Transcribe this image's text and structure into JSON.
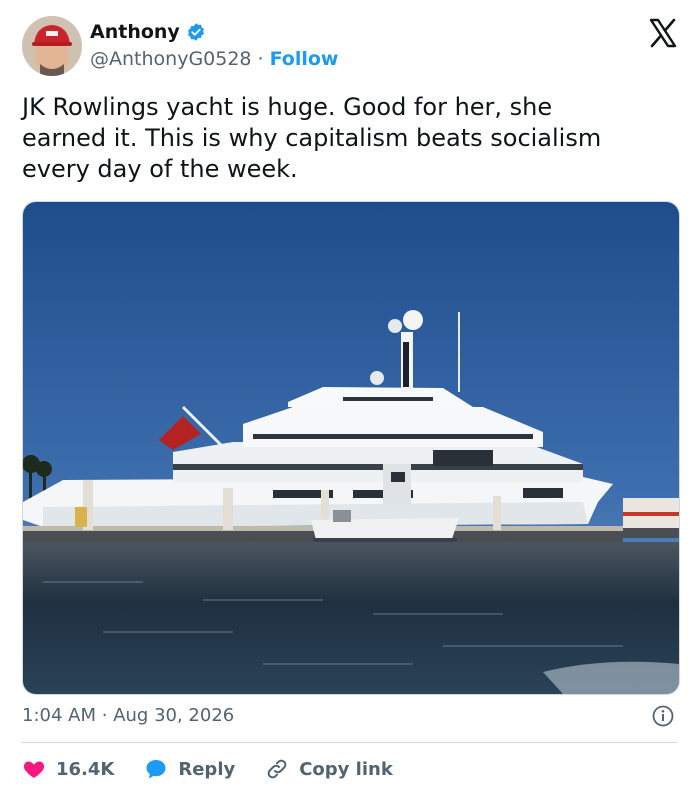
{
  "author": {
    "name": "Anthony",
    "handle": "@AnthonyG0528",
    "separator": "·",
    "follow_label": "Follow"
  },
  "tweet": {
    "text": "JK Rowlings yacht is huge. Good for her, she\nearned it. This is why capitalism beats socialism\nevery day of the week.",
    "time": "1:04 AM",
    "date_separator": "·",
    "date": "Aug 30, 2026"
  },
  "actions": {
    "like_count": "16.4K",
    "reply_label": "Reply",
    "copy_link_label": "Copy link"
  },
  "colors": {
    "accent": "#1d9bf0",
    "like": "#f91880",
    "text_primary": "#0f1419",
    "text_secondary": "#536471"
  },
  "icons": {
    "verified": "verified-badge-icon",
    "brand": "x-logo-icon",
    "info": "info-icon",
    "like": "heart-icon",
    "reply": "speech-bubble-icon",
    "copy_link": "link-icon"
  }
}
